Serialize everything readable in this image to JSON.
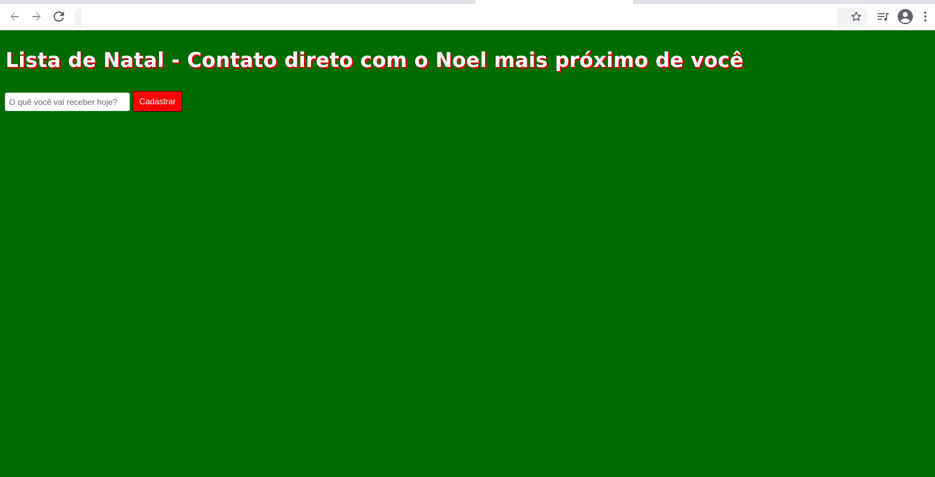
{
  "browser": {
    "icons": {
      "back": "arrow-left-icon",
      "forward": "arrow-right-icon",
      "reload": "reload-icon",
      "bookmark": "star-icon",
      "media": "playlist-icon",
      "profile": "account-circle-icon",
      "menu": "kebab-menu-icon"
    },
    "url": ""
  },
  "page": {
    "title": "Lista de Natal - Contato direto com o Noel mais próximo de você",
    "form": {
      "input_placeholder": "O quê você vai receber hoje?",
      "input_value": "",
      "submit_label": "Cadastrar"
    }
  },
  "colors": {
    "background": "#006b00",
    "title_text": "#ffffff",
    "title_shadow": "#e00000",
    "button_bg": "#ff0000",
    "button_text": "#ffffff"
  }
}
